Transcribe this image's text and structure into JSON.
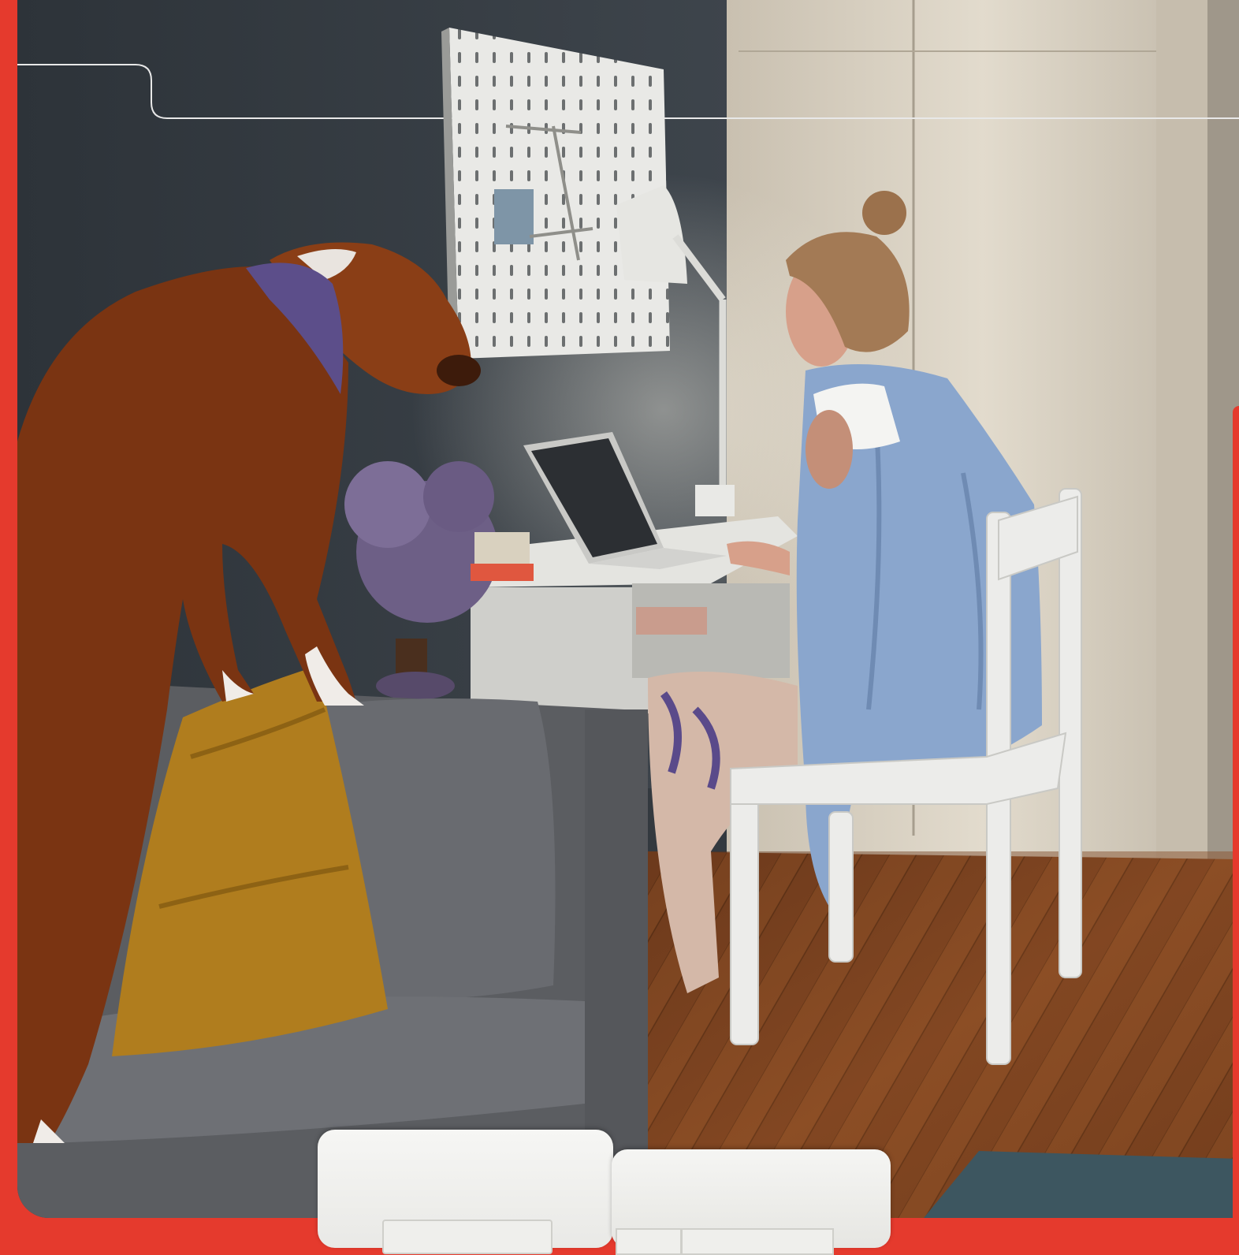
{
  "scene": {
    "description_icon": "photo-home-office",
    "colors": {
      "brand_red": "#e53a2d",
      "wall": "#33393f",
      "wardrobe": "#d9d2c4",
      "floor": "#7a4321",
      "sofa": "#55575b",
      "cushion": "#b07d1e",
      "dog": "#7a3412",
      "shirt": "#8ea8cf",
      "switch": "#f2f2f0"
    }
  }
}
